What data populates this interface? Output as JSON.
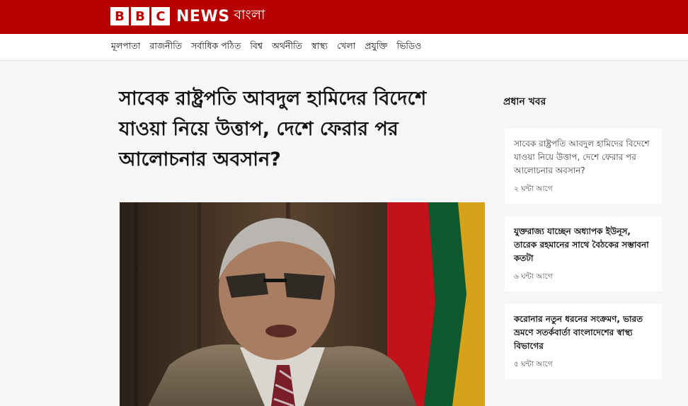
{
  "brand": {
    "letters": [
      "B",
      "B",
      "C"
    ],
    "news": "NEWS",
    "language": "বাংলা",
    "color": "#b80000"
  },
  "nav": {
    "items": [
      {
        "label": "মূলপাতা"
      },
      {
        "label": "রাজনীতি"
      },
      {
        "label": "সর্বাধিক পঠিত"
      },
      {
        "label": "বিশ্ব"
      },
      {
        "label": "অর্থনীতি"
      },
      {
        "label": "স্বাস্থ্য"
      },
      {
        "label": "খেলা"
      },
      {
        "label": "প্রযুক্তি"
      },
      {
        "label": "ভিডিও"
      }
    ]
  },
  "article": {
    "headline": "সাবেক রাষ্ট্রপতি আবদুল হামিদের বিদেশে যাওয়া নিয়ে উত্তাপ, দেশে ফেরার পর আলোচনার অবসান?"
  },
  "sidebar": {
    "title": "প্রধান খবর",
    "cards": [
      {
        "title": "সাবেক রাষ্ট্রপতি আবদুল হামিদের বিদেশে যাওয়া নিয়ে উত্তাপ, দেশে ফেরার পর আলোচনার অবসান?",
        "time": "২ ঘন্টা আগে"
      },
      {
        "title": "যুক্তরাজ্য যাচ্ছেন অধ্যাপক ইউনূস, তারেক রহমানের সাথে বৈঠকের সম্ভাবনা কতটা",
        "time": "৬ ঘন্টা আগে"
      },
      {
        "title": "করোনার নতুন ধরনের সংক্রমণ, ভারত ভ্রমণে সতর্কবার্তা বাংলাদেশের স্বাস্থ্য বিভাগের",
        "time": "৫ ঘন্টা আগে"
      }
    ]
  }
}
